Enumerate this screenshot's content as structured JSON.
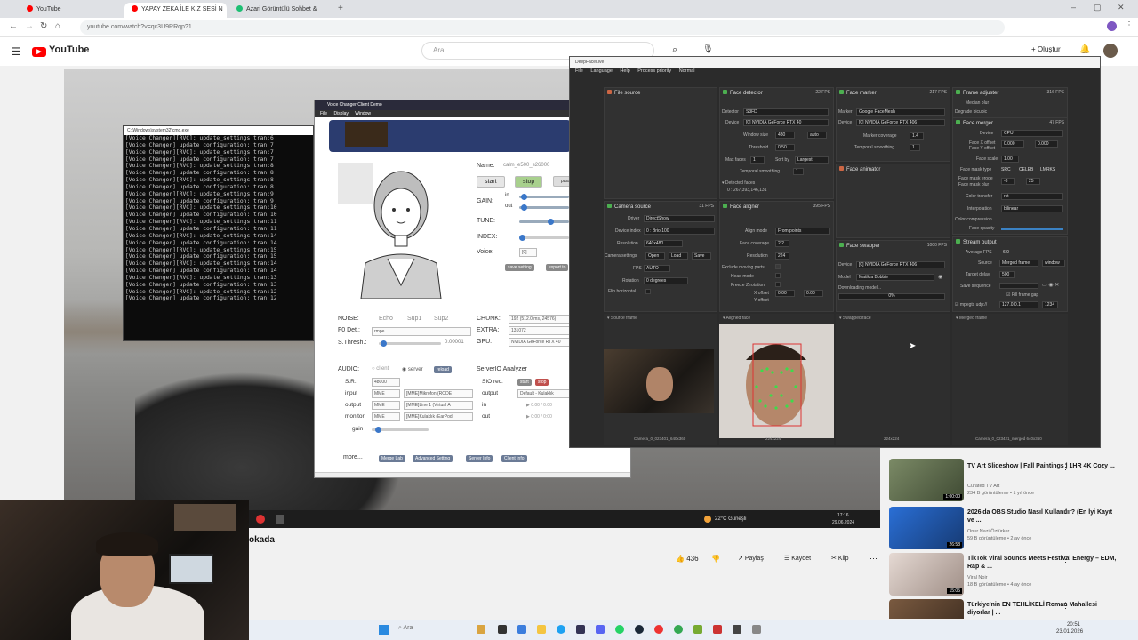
{
  "browser": {
    "tabs": [
      {
        "label": "YouTube",
        "color": "#ff0000"
      },
      {
        "label": "YAPAY ZEKA İLE KIZ SESİ N",
        "color": "#ff0000"
      },
      {
        "label": "Azari Görüntülü Sohbet &",
        "color": "#1dbf73"
      }
    ],
    "url": "youtube.com/watch?v=qc3U9RRqp?1"
  },
  "youtube": {
    "logo": "YouTube",
    "search_placeholder": "Ara",
    "create_label": "Oluştur",
    "video_title": "okada",
    "likes": "436",
    "share": "Paylaş",
    "save": "Kaydet",
    "clip": "Klip"
  },
  "console": {
    "title": "C:\\Windows\\system32\\cmd.exe",
    "lines": [
      "[Voice Changer][RVC]: update_settings tran:6",
      "[Voice Changer] update configuration: tran 7",
      "[Voice Changer][RVC]: update_settings tran:7",
      "[Voice Changer] update configuration: tran 7",
      "[Voice Changer][RVC]: update_settings tran:8",
      "[Voice Changer] update configuration: tran 8",
      "[Voice Changer][RVC]: update_settings tran:8",
      "[Voice Changer] update configuration: tran 8",
      "[Voice Changer][RVC]: update_settings tran:9",
      "[Voice Changer] update configuration: tran 9",
      "[Voice Changer][RVC]: update_settings tran:10",
      "[Voice Changer] update configuration: tran 10",
      "[Voice Changer][RVC]: update_settings tran:11",
      "[Voice Changer] update configuration: tran 11",
      "[Voice Changer][RVC]: update_settings tran:14",
      "[Voice Changer] update configuration: tran 14",
      "[Voice Changer][RVC]: update_settings tran:15",
      "[Voice Changer] update configuration: tran 15",
      "[Voice Changer][RVC]: update_settings tran:14",
      "[Voice Changer] update configuration: tran 14",
      "[Voice Changer][RVC]: update_settings tran:13",
      "[Voice Changer] update configuration: tran 13",
      "[Voice Changer][RVC]: update_settings tran:12",
      "[Voice Changer] update configuration: tran 12"
    ]
  },
  "voice_changer": {
    "title": "Voice Changer Client Demo",
    "menu": [
      "File",
      "Display",
      "Window"
    ],
    "name_label": "Name:",
    "name_value": "calm_e500_s26000",
    "start": "start",
    "stop": "stop",
    "passthru": "passt",
    "gain_label": "GAIN:",
    "in_label": "in",
    "out_label": "out",
    "tune_label": "TUNE:",
    "index_label": "INDEX:",
    "voice_label": "Voice:",
    "voice_value": "[0]",
    "save_setting": "save setting",
    "export": "export to",
    "noise_label": "NOISE:",
    "noise_opts": [
      "Echo",
      "Sup1",
      "Sup2"
    ],
    "f0_label": "F0 Det.:",
    "f0_value": "rmpe",
    "sthresh_label": "S.Thresh.:",
    "sthresh_value": "0.00001",
    "chunk_label": "CHUNK:",
    "chunk_value": "192 (512.0 ms, 24576)",
    "extra_label": "EXTRA:",
    "extra_value": "131072",
    "gpu_label": "GPU:",
    "gpu_value": "NVIDIA GeForce RTX 40",
    "audio_label": "AUDIO:",
    "client": "client",
    "server": "server",
    "reload": "reload",
    "sr_label": "S.R.",
    "sr_value": "48000",
    "input_label": "input",
    "output_label": "output",
    "monitor_label": "monitor",
    "gain2_label": "gain",
    "mme": "MME",
    "input_dev": "[MME]Mikrofon (RODE",
    "output_dev": "[MME]Line 1 (Virtual A",
    "monitor_dev": "[MME]Kulaklık (EarPod",
    "serverio": "ServerIO Analyzer",
    "sio_rec": "SIO rec.",
    "sio_in": "in",
    "sio_out": "out",
    "sio_output": "output",
    "sio_output_val": "Default - Kulaklık",
    "time_in": "0:00 / 0:00",
    "time_out": "0:00 / 0:00",
    "more": "more...",
    "more_buttons": [
      "Merge Lab",
      "Advanced Setting",
      "Server Info",
      "Client Info"
    ]
  },
  "dfl": {
    "title": "DeepFaceLive",
    "menu": [
      "File",
      "Language",
      "Help",
      "Process priority",
      "Normal"
    ],
    "file_source": "File source",
    "camera_source": "Camera source",
    "cam_fps": "31 FPS",
    "driver_label": "Driver",
    "driver_val": "DirectShow",
    "devidx_label": "Device index",
    "devidx_val": "0 : Brio 100",
    "res_label": "Resolution",
    "res_val": "640x480",
    "camset_label": "Camera settings",
    "camset_btns": [
      "Open",
      "Load",
      "Save"
    ],
    "fps_label": "FPS",
    "fps_val": "AUTO",
    "rot_label": "Rotation",
    "rot_val": "0 degrees",
    "flip_label": "Flip horizontal",
    "face_detector": "Face detector",
    "fd_fps": "22 FPS",
    "detector_label": "Detector",
    "detector_val": "S3FD",
    "device_label": "Device",
    "fd_device_val": "[0] NVIDIA GeForce RTX 40",
    "winsize_label": "Window size",
    "winsize_val": "480",
    "auto": "auto",
    "thresh_label": "Threshold",
    "thresh_val": "0.50",
    "maxfaces_label": "Max faces",
    "maxfaces_val": "1",
    "sortby_label": "Sort by",
    "sortby_val": "Largest",
    "tempsmooth_label": "Temporal smoothing",
    "tempsmooth_val": "1",
    "detected_faces": "Detected faces",
    "detected_val": "0 : 267,393,146,131",
    "face_marker": "Face marker",
    "fm_fps": "217 FPS",
    "marker_label": "Marker",
    "marker_val": "Google FaceMesh",
    "fm_device_val": "[0] NVIDIA GeForce RTX 406",
    "markcov_label": "Marker coverage",
    "markcov_val": "1.4",
    "fm_temp_label": "Temporal smoothing",
    "fm_temp_val": "1",
    "face_animator": "Face animator",
    "face_aligner": "Face aligner",
    "fa_fps": "395 FPS",
    "alignmode_label": "Align mode",
    "alignmode_val": "From points",
    "facecov_label": "Face coverage",
    "facecov_val": "2.2",
    "fa_res_label": "Resolution",
    "fa_res_val": "224",
    "exclmoving": "Exclude moving parts",
    "headmode": "Head mode",
    "freezez": "Freeze Z rotation",
    "xoff": "X offset",
    "yoff": "Y offset",
    "off_val": "0.00",
    "face_swapper": "Face swapper",
    "fs_fps": "1000 FPS",
    "fs_device_val": "[0] NVIDIA GeForce RTX 406",
    "model_label": "Model",
    "model_val": "Matilda Bobbie",
    "downloading": "Downloading model...",
    "dl_pct": "0%",
    "frame_adjuster": "Frame adjuster",
    "fadj_fps": "316 FPS",
    "median_blur": "Median blur",
    "degrade_bicubic": "Degrade bicubic",
    "face_merger": "Face merger",
    "fmg_fps": "47 FPS",
    "fmg_device_val": "CPU",
    "fxoff": "Face X offset",
    "fyoff": "Face Y offset",
    "fxoff_val": "0.000",
    "fscale": "Face scale",
    "fscale_val": "1.00",
    "fmask": "Face mask type",
    "fmask_opts": [
      "SRC",
      "CELEB",
      "LMRKS"
    ],
    "fmerode": "Face mask erode",
    "fmerode_val": "-8",
    "fmblur": "Face mask blur",
    "fmblur_val": "25",
    "colortransfer": "Color transfer",
    "colortransfer_val": "rct",
    "interp": "Interpolation",
    "interp_val": "bilinear",
    "colorcomp": "Color compression",
    "faceopacity": "Face opacity",
    "stream_output": "Stream output",
    "avgfps": "Average FPS",
    "avgfps_val": "6.0",
    "source_label": "Source",
    "source_val": "Merged frame",
    "window": "window",
    "targetdelay": "Target delay",
    "targetdelay_val": "500",
    "saveseq": "Save sequence",
    "fillgap": "Fill frame gap",
    "mpegts": "mpegts udp://",
    "ip_val": "127.0.0.1",
    "port_val": "1234",
    "prev_source": "Source frame",
    "prev_aligned": "Aligned face",
    "prev_swapped": "Swapped face",
    "prev_merged": "Merged frame",
    "foot_source": "Camera_0_023401_640x360",
    "foot_aligned": "224x224",
    "foot_swapped": "224x224",
    "foot_merged": "Camera_0_023421_merged 640x360"
  },
  "recommendations": [
    {
      "title": "TV Art Slideshow | Fall Paintings | 1HR 4K Cozy ...",
      "channel": "Curated TV Art",
      "meta": "234 B görüntüleme • 1 yıl önce",
      "duration": "1:00:00",
      "color": "#7b8a66"
    },
    {
      "title": "2026'da OBS Studio Nasıl Kullanılır? (En İyi Kayıt ve ...",
      "channel": "Onur Nazi Öztürker",
      "meta": "59 B görüntüleme • 2 ay önce",
      "duration": "26:58",
      "color": "#2a6fd6"
    },
    {
      "title": "TikTok Viral Sounds Meets Festival Energy – EDM, Rap & ...",
      "channel": "Viral Noir",
      "meta": "18 B görüntüleme • 4 ay önce",
      "duration": "15:05",
      "color": "#d8c9c3"
    },
    {
      "title": "Türkiye'nin EN TEHLİKELİ Roman Mahallesi diyorlar | ...",
      "channel": "",
      "meta": "",
      "duration": "",
      "color": "#7a5a40"
    }
  ],
  "taskbar": {
    "search": "Ara",
    "weather": "22°C Güneşli",
    "time": "20:51",
    "date": "23.01.2026",
    "video_time": "17:16",
    "video_date": "29.06.2024"
  }
}
